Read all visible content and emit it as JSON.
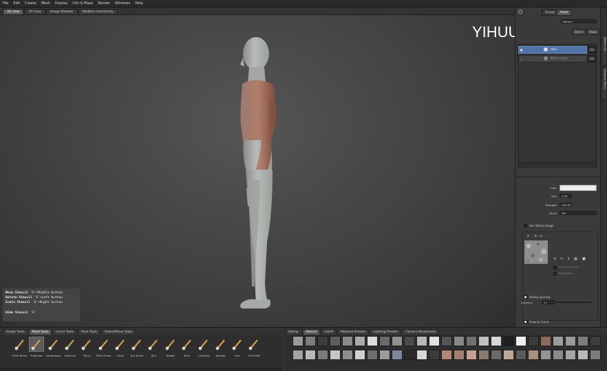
{
  "menu": [
    "File",
    "Edit",
    "Create",
    "Mesh",
    "Display",
    "UVs & Maps",
    "Render",
    "Windows",
    "Help"
  ],
  "view_tabs": [
    "3D View",
    "UV View",
    "Image Browser",
    "Mudbox Community"
  ],
  "hud": {
    "rows": [
      {
        "label": "Move Stencil",
        "hint": "'S'+Middle button"
      },
      {
        "label": "Rotate Stencil",
        "hint": "'S'+Left button"
      },
      {
        "label": "Scale Stencil",
        "hint": "'S'+Right button"
      }
    ],
    "hide_label": "Hide Stencil",
    "hide_hint": "'S'"
  },
  "watermark": "YIHUU.COM",
  "right_panel": {
    "top_tabs": [
      "Sculpt",
      "Paint"
    ],
    "blend_mode": "Normal",
    "layer_buttons": [
      "Select",
      "Show"
    ],
    "layers": [
      {
        "name": "skin",
        "opacity": "100"
      },
      {
        "name": "Base Layer",
        "opacity": "100"
      }
    ],
    "props": [
      {
        "label": "Color",
        "value": ""
      },
      {
        "label": "Size",
        "value": "2.56"
      },
      {
        "label": "Strength",
        "value": "100.00"
      },
      {
        "label": "Mirror",
        "value": "Off"
      }
    ],
    "use_stamp": "Use Stamp Image",
    "stamp_opts": [
      "Orient To Stroke",
      "Randomize"
    ],
    "stamp_spacing": "Stamp Spacing",
    "distance_label": "Distance",
    "distance_value": "17",
    "snap_curve": "Snap to Curve"
  },
  "side_tabs": [
    "Object List",
    "Viewport Filters"
  ],
  "tray_tabs_left": [
    "Sculpt Tools",
    "Paint Tools",
    "Curve Tools",
    "Pose Tools",
    "Select/Move Tools"
  ],
  "tray_tabs_right": [
    "Stamp",
    "Stencil",
    "Falloff",
    "Material Presets",
    "Lighting Presets",
    "Camera Bookmarks"
  ],
  "tools": [
    {
      "name": "paint-brush",
      "label": "Paint Brush"
    },
    {
      "name": "projection",
      "label": "Projection"
    },
    {
      "name": "eyedropper",
      "label": "Eyedropper"
    },
    {
      "name": "airbrush",
      "label": "Airbrush"
    },
    {
      "name": "pencil",
      "label": "Pencil"
    },
    {
      "name": "paint-erase",
      "label": "Paint Erase"
    },
    {
      "name": "clone",
      "label": "Clone"
    },
    {
      "name": "dry-brush",
      "label": "Dry Brush"
    },
    {
      "name": "blur",
      "label": "Blur"
    },
    {
      "name": "dodge",
      "label": "Dodge"
    },
    {
      "name": "burn",
      "label": "Burn"
    },
    {
      "name": "contrast",
      "label": "Contrast"
    },
    {
      "name": "sponge",
      "label": "Sponge"
    },
    {
      "name": "hue",
      "label": "Hue"
    },
    {
      "name": "hue-shift",
      "label": "Hue Shift"
    }
  ],
  "colors": {
    "accent": "#5a7fb8",
    "skin_layer": "#4f72a8",
    "tool_selected": "#5b5b5b"
  }
}
